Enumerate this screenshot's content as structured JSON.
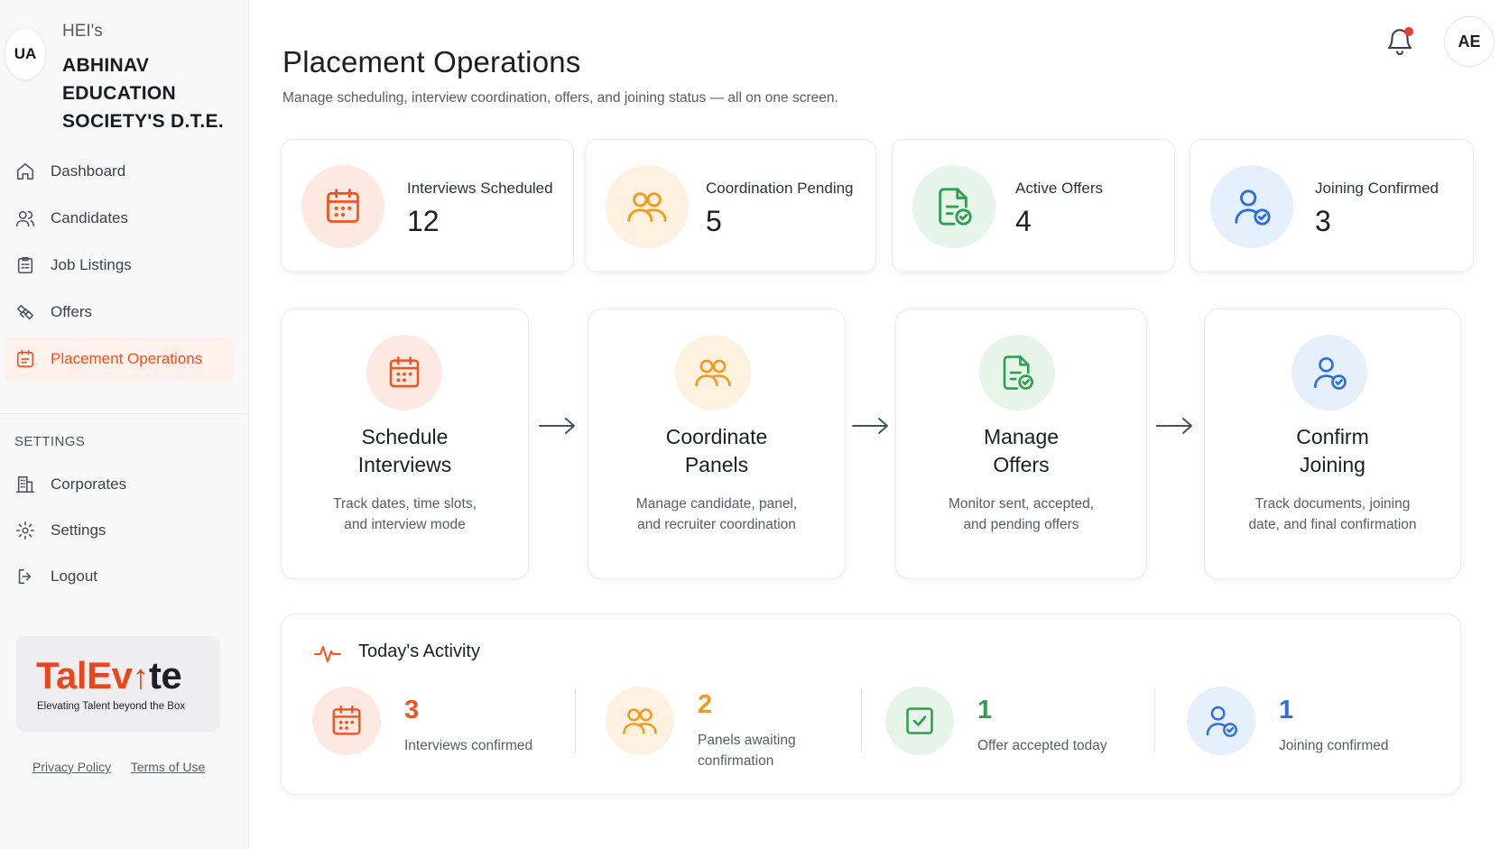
{
  "org": {
    "avatar_initials": "UA",
    "prefix": "HEI's",
    "name": "ABHINAV EDUCATION SOCIETY'S D.T.E."
  },
  "nav": {
    "items": [
      {
        "label": "Dashboard",
        "icon": "home-icon"
      },
      {
        "label": "Candidates",
        "icon": "users-icon"
      },
      {
        "label": "Job Listings",
        "icon": "clipboard-icon"
      },
      {
        "label": "Offers",
        "icon": "handshake-icon"
      },
      {
        "label": "Placement Operations",
        "icon": "calendar-icon",
        "active": true
      }
    ],
    "settings_label": "SETTINGS",
    "settings_items": [
      {
        "label": "Corporates",
        "icon": "building-icon"
      },
      {
        "label": "Settings",
        "icon": "gear-icon"
      },
      {
        "label": "Logout",
        "icon": "logout-icon"
      }
    ]
  },
  "brand": {
    "word_a": "TalEv",
    "word_b": "te",
    "tagline": "Elevating Talent beyond the Box"
  },
  "legal": {
    "privacy": "Privacy Policy",
    "terms": "Terms of Use"
  },
  "header": {
    "title": "Placement Operations",
    "subtitle": "Manage scheduling, interview coordination, offers, and joining status — all on one screen.",
    "user_initials": "AE"
  },
  "stats": [
    {
      "label": "Interviews Scheduled",
      "value": "12",
      "icon": "calendar-icon",
      "color": "#f0531f"
    },
    {
      "label": "Coordination Pending",
      "value": "5",
      "icon": "users-icon",
      "color": "#f29a1c"
    },
    {
      "label": "Active Offers",
      "value": "4",
      "icon": "document-check-icon",
      "color": "#2f9e4f"
    },
    {
      "label": "Joining Confirmed",
      "value": "3",
      "icon": "user-check-icon",
      "color": "#2a6fe0"
    }
  ],
  "process": [
    {
      "title": "Schedule\nInterviews",
      "desc": "Track dates, time slots,\nand interview mode",
      "icon": "calendar-icon"
    },
    {
      "title": "Coordinate\nPanels",
      "desc": "Manage candidate, panel,\nand recruiter coordination",
      "icon": "users-icon"
    },
    {
      "title": "Manage\nOffers",
      "desc": "Monitor sent, accepted,\nand pending offers",
      "icon": "document-check-icon"
    },
    {
      "title": "Confirm\nJoining",
      "desc": "Track documents, joining\ndate, and final confirmation",
      "icon": "user-check-icon"
    }
  ],
  "activity": {
    "title": "Today's Activity",
    "items": [
      {
        "value": "3",
        "text": "Interviews confirmed",
        "color": "#f0531f",
        "icon": "calendar-icon"
      },
      {
        "value": "2",
        "text": "Panels awaiting\nconfirmation",
        "color": "#f29a1c",
        "icon": "users-icon"
      },
      {
        "value": "1",
        "text": "Offer accepted today",
        "color": "#2f9e4f",
        "icon": "checkbox-icon"
      },
      {
        "value": "1",
        "text": "Joining confirmed",
        "color": "#2a6fe0",
        "icon": "user-check-icon"
      }
    ]
  }
}
